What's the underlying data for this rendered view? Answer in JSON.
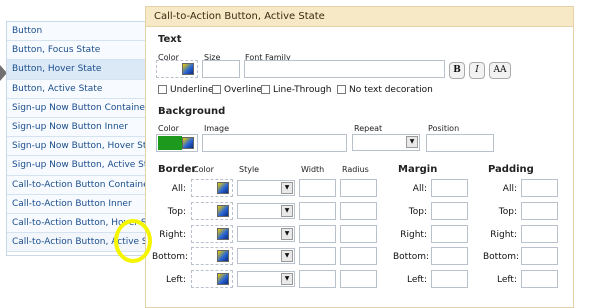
{
  "sidebar": {
    "items": [
      {
        "label": "Button"
      },
      {
        "label": "Button, Focus State"
      },
      {
        "label": "Button, Hover State"
      },
      {
        "label": "Button, Active State"
      },
      {
        "label": "Sign-up Now Button Container"
      },
      {
        "label": "Sign-up Now Button Inner"
      },
      {
        "label": "Sign-up Now Button, Hover State"
      },
      {
        "label": "Sign-up Now Button, Active State"
      },
      {
        "label": "Call-to-Action Button Container"
      },
      {
        "label": "Call-to-Action Button Inner"
      },
      {
        "label": "Call-to-Action Button, Hover State"
      },
      {
        "label": "Call-to-Action Button, Active State"
      }
    ]
  },
  "panel": {
    "title": "Call-to-Action Button, Active State",
    "text": {
      "heading": "Text",
      "color_label": "Color",
      "size_label": "Size",
      "font_family_label": "Font Family",
      "bold": "B",
      "italic": "I",
      "caps": "AA",
      "underline": "Underline",
      "overline": "Overline",
      "line_through": "Line-Through",
      "no_decoration": "No text decoration"
    },
    "background": {
      "heading": "Background",
      "color_label": "Color",
      "image_label": "Image",
      "repeat_label": "Repeat",
      "position_label": "Position",
      "color_value": "#1d9a1d"
    },
    "border": {
      "heading": "Border",
      "color_label": "Color",
      "style_label": "Style",
      "width_label": "Width",
      "radius_label": "Radius",
      "rows": [
        "All:",
        "Top:",
        "Right:",
        "Bottom:",
        "Left:"
      ]
    },
    "margin": {
      "heading": "Margin",
      "rows": [
        "All:",
        "Top:",
        "Right:",
        "Bottom:",
        "Left:"
      ]
    },
    "padding": {
      "heading": "Padding",
      "rows": [
        "All:",
        "Top:",
        "Right:",
        "Bottom:",
        "Left:"
      ]
    }
  }
}
